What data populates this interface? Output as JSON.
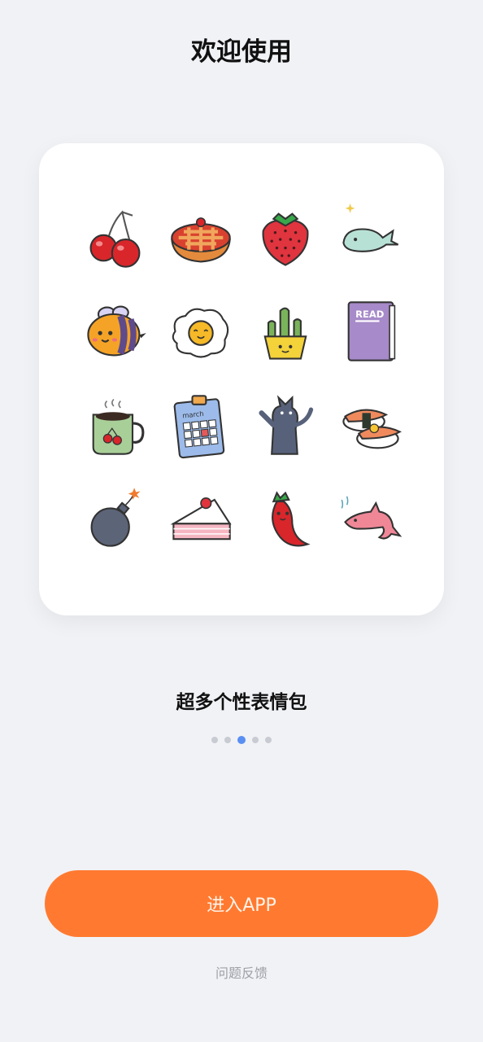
{
  "header": {
    "title": "欢迎使用"
  },
  "showcase": {
    "caption": "超多个性表情包",
    "stickers": [
      {
        "icon": "cherries-icon"
      },
      {
        "icon": "pie-icon"
      },
      {
        "icon": "strawberry-icon"
      },
      {
        "icon": "whale-icon"
      },
      {
        "icon": "bee-icon"
      },
      {
        "icon": "fried-egg-icon"
      },
      {
        "icon": "cactus-pot-icon"
      },
      {
        "icon": "book-icon",
        "text": "READ"
      },
      {
        "icon": "coffee-mug-icon"
      },
      {
        "icon": "calendar-icon",
        "text": "march"
      },
      {
        "icon": "cat-icon"
      },
      {
        "icon": "sushi-icon"
      },
      {
        "icon": "bomb-icon"
      },
      {
        "icon": "cake-slice-icon"
      },
      {
        "icon": "chili-pepper-icon"
      },
      {
        "icon": "dolphin-icon"
      }
    ]
  },
  "pager": {
    "total": 5,
    "active_index": 2,
    "active_color": "#5a8ff2",
    "inactive_color": "#c9cbd2"
  },
  "actions": {
    "enter_label": "进入APP",
    "enter_color": "#ff7a30",
    "feedback_label": "问题反馈"
  }
}
